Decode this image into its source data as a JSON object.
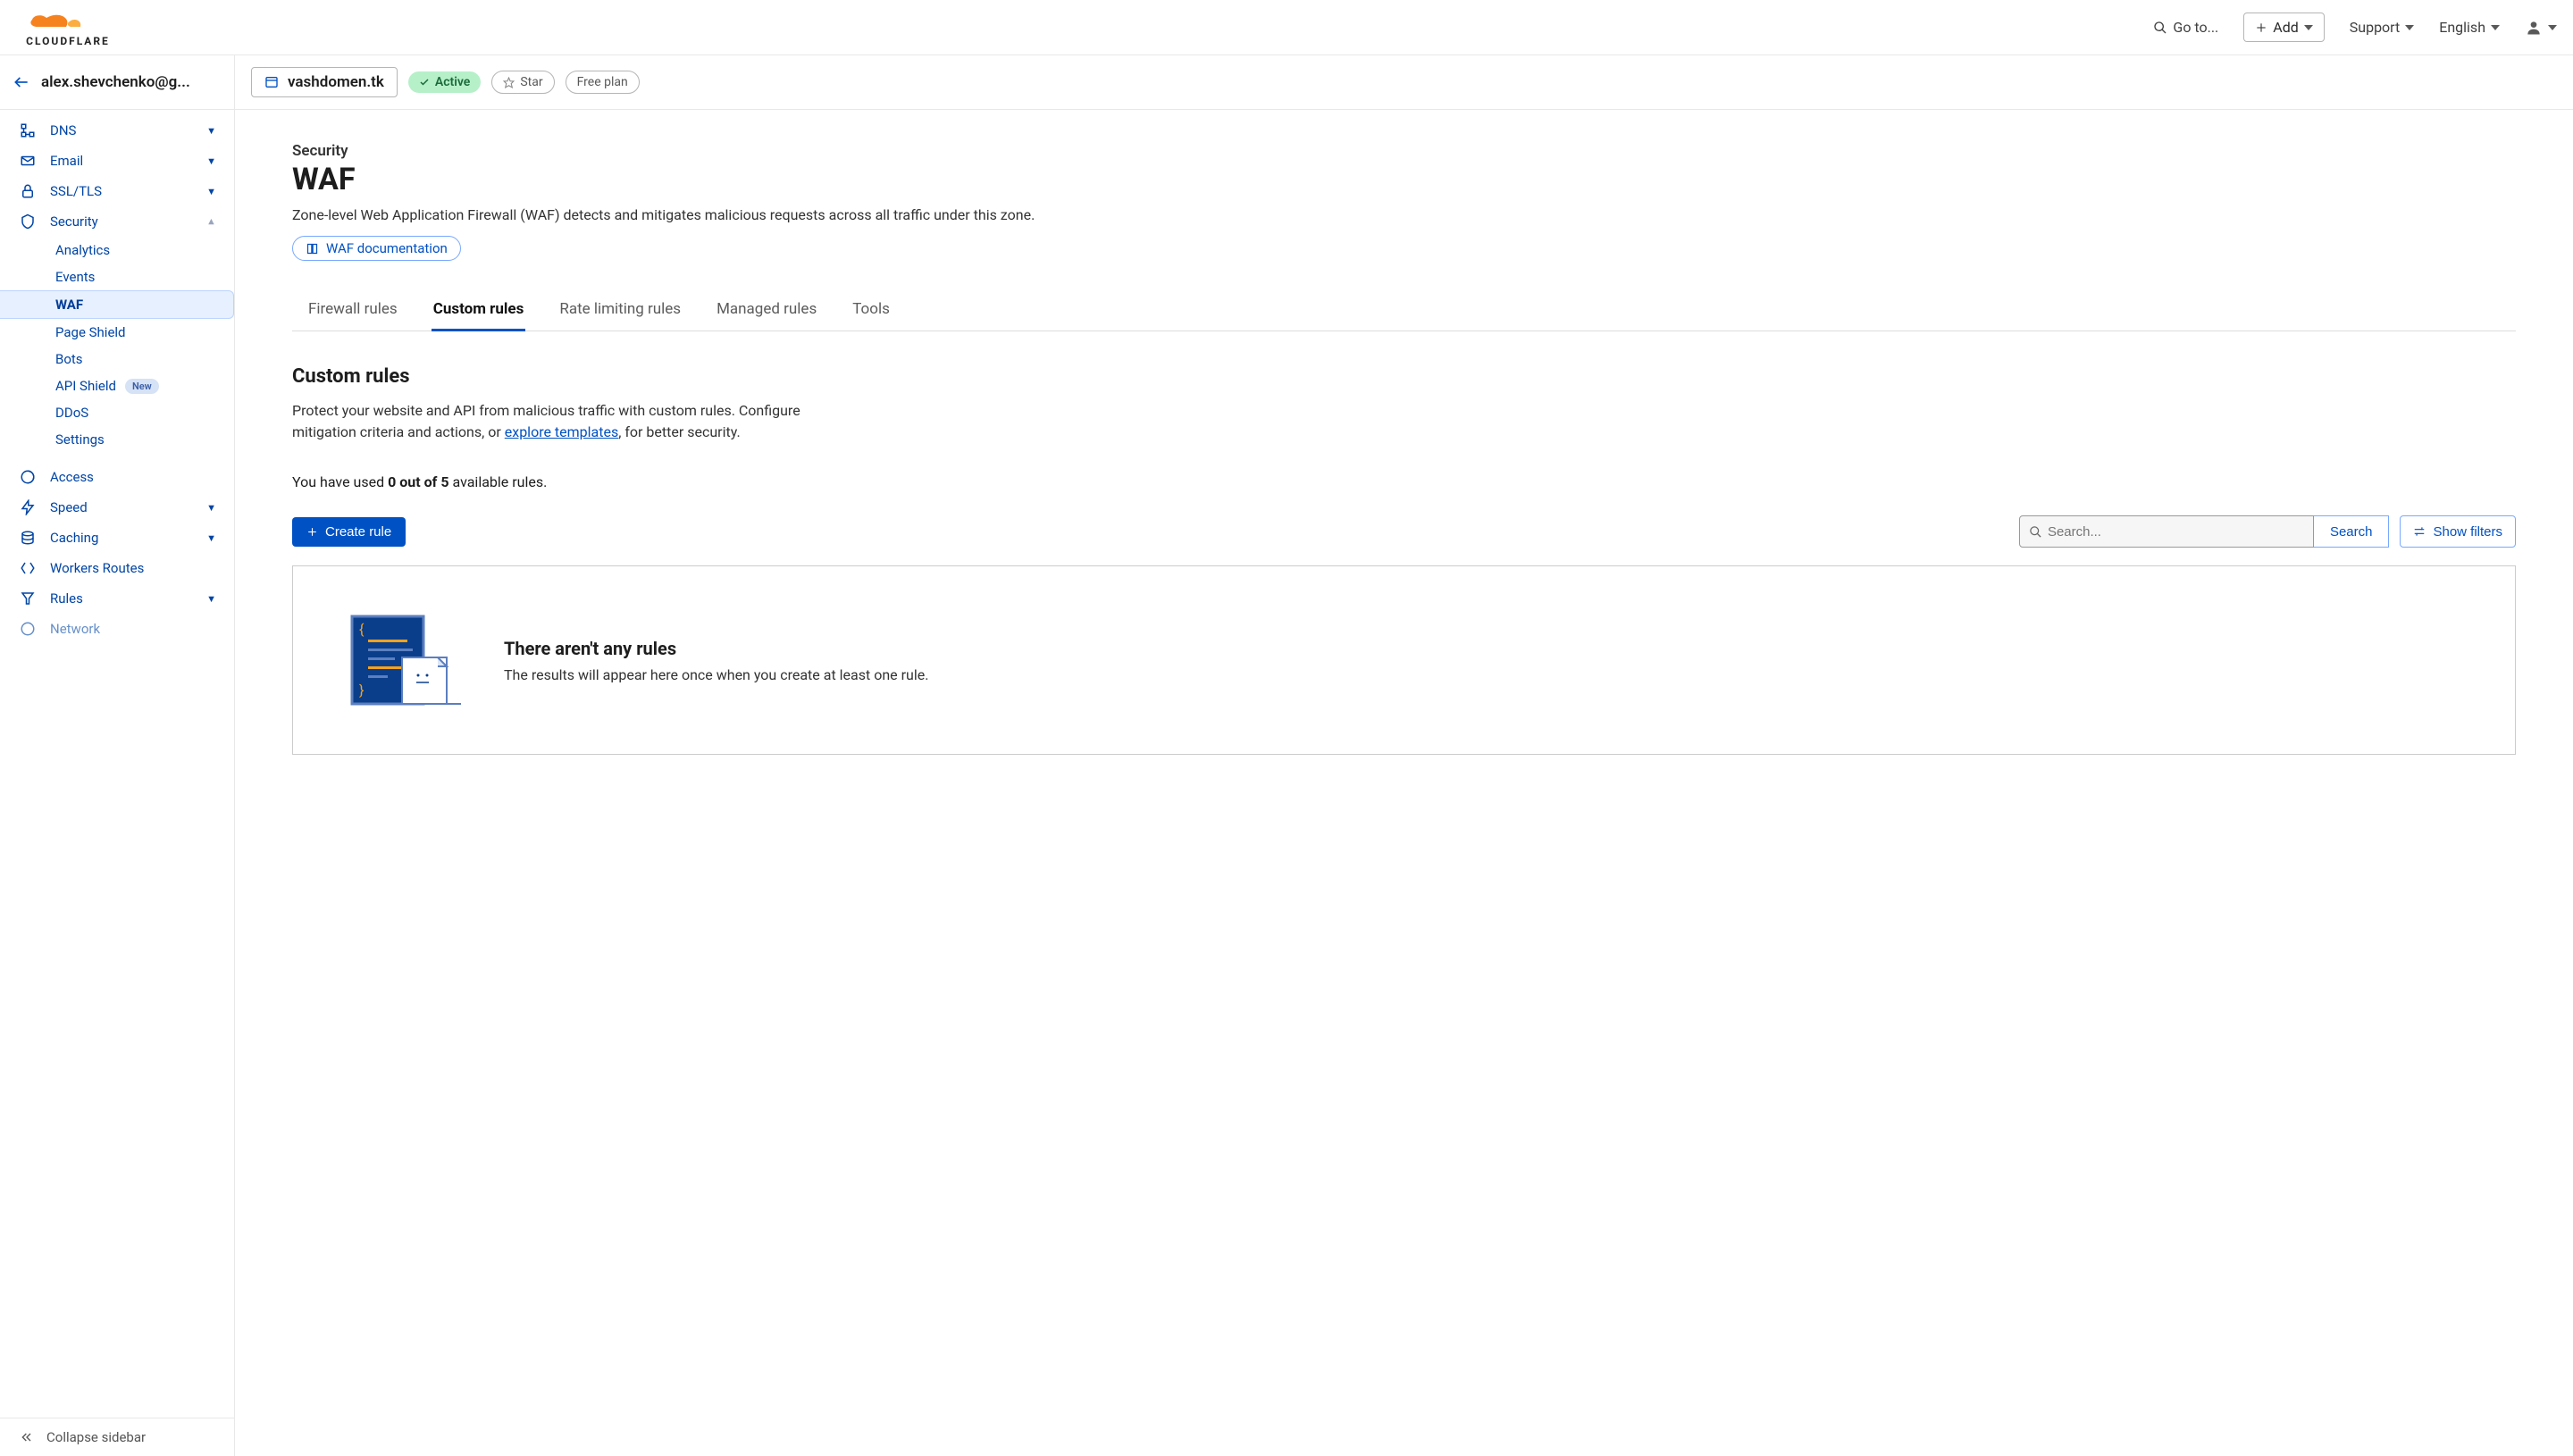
{
  "header": {
    "goto_label": "Go to...",
    "add_label": "Add",
    "support_label": "Support",
    "language_label": "English"
  },
  "account": {
    "name": "alex.shevchenko@g..."
  },
  "domain": {
    "name": "vashdomen.tk",
    "status": "Active",
    "star_label": "Star",
    "plan_label": "Free plan"
  },
  "sidebar": {
    "items": [
      {
        "label": "DNS",
        "icon": "dns"
      },
      {
        "label": "Email",
        "icon": "email"
      },
      {
        "label": "SSL/TLS",
        "icon": "lock"
      },
      {
        "label": "Security",
        "icon": "shield",
        "expanded": true
      },
      {
        "label": "Access",
        "icon": "access"
      },
      {
        "label": "Speed",
        "icon": "speed"
      },
      {
        "label": "Caching",
        "icon": "caching"
      },
      {
        "label": "Workers Routes",
        "icon": "workers"
      },
      {
        "label": "Rules",
        "icon": "rules"
      },
      {
        "label": "Network",
        "icon": "network"
      }
    ],
    "security_sub": [
      {
        "label": "Analytics"
      },
      {
        "label": "Events"
      },
      {
        "label": "WAF",
        "active": true
      },
      {
        "label": "Page Shield"
      },
      {
        "label": "Bots"
      },
      {
        "label": "API Shield",
        "badge": "New"
      },
      {
        "label": "DDoS"
      },
      {
        "label": "Settings"
      }
    ],
    "collapse_label": "Collapse sidebar"
  },
  "page": {
    "crumb": "Security",
    "title": "WAF",
    "desc": "Zone-level Web Application Firewall (WAF) detects and mitigates malicious requests across all traffic under this zone.",
    "doc_link_label": "WAF documentation"
  },
  "tabs": [
    {
      "label": "Firewall rules"
    },
    {
      "label": "Custom rules",
      "active": true
    },
    {
      "label": "Rate limiting rules"
    },
    {
      "label": "Managed rules"
    },
    {
      "label": "Tools"
    }
  ],
  "section": {
    "title": "Custom rules",
    "desc_part1": "Protect your website and API from malicious traffic with custom rules. Configure mitigation criteria and actions, or ",
    "link_text": "explore templates",
    "desc_part2": ", for better security.",
    "usage_prefix": "You have used ",
    "usage_bold": "0 out of 5",
    "usage_suffix": " available rules."
  },
  "toolbar": {
    "create_label": "Create rule",
    "search_placeholder": "Search...",
    "search_btn": "Search",
    "filters_btn": "Show filters"
  },
  "empty": {
    "title": "There aren't any rules",
    "desc": "The results will appear here once when you create at least one rule."
  }
}
